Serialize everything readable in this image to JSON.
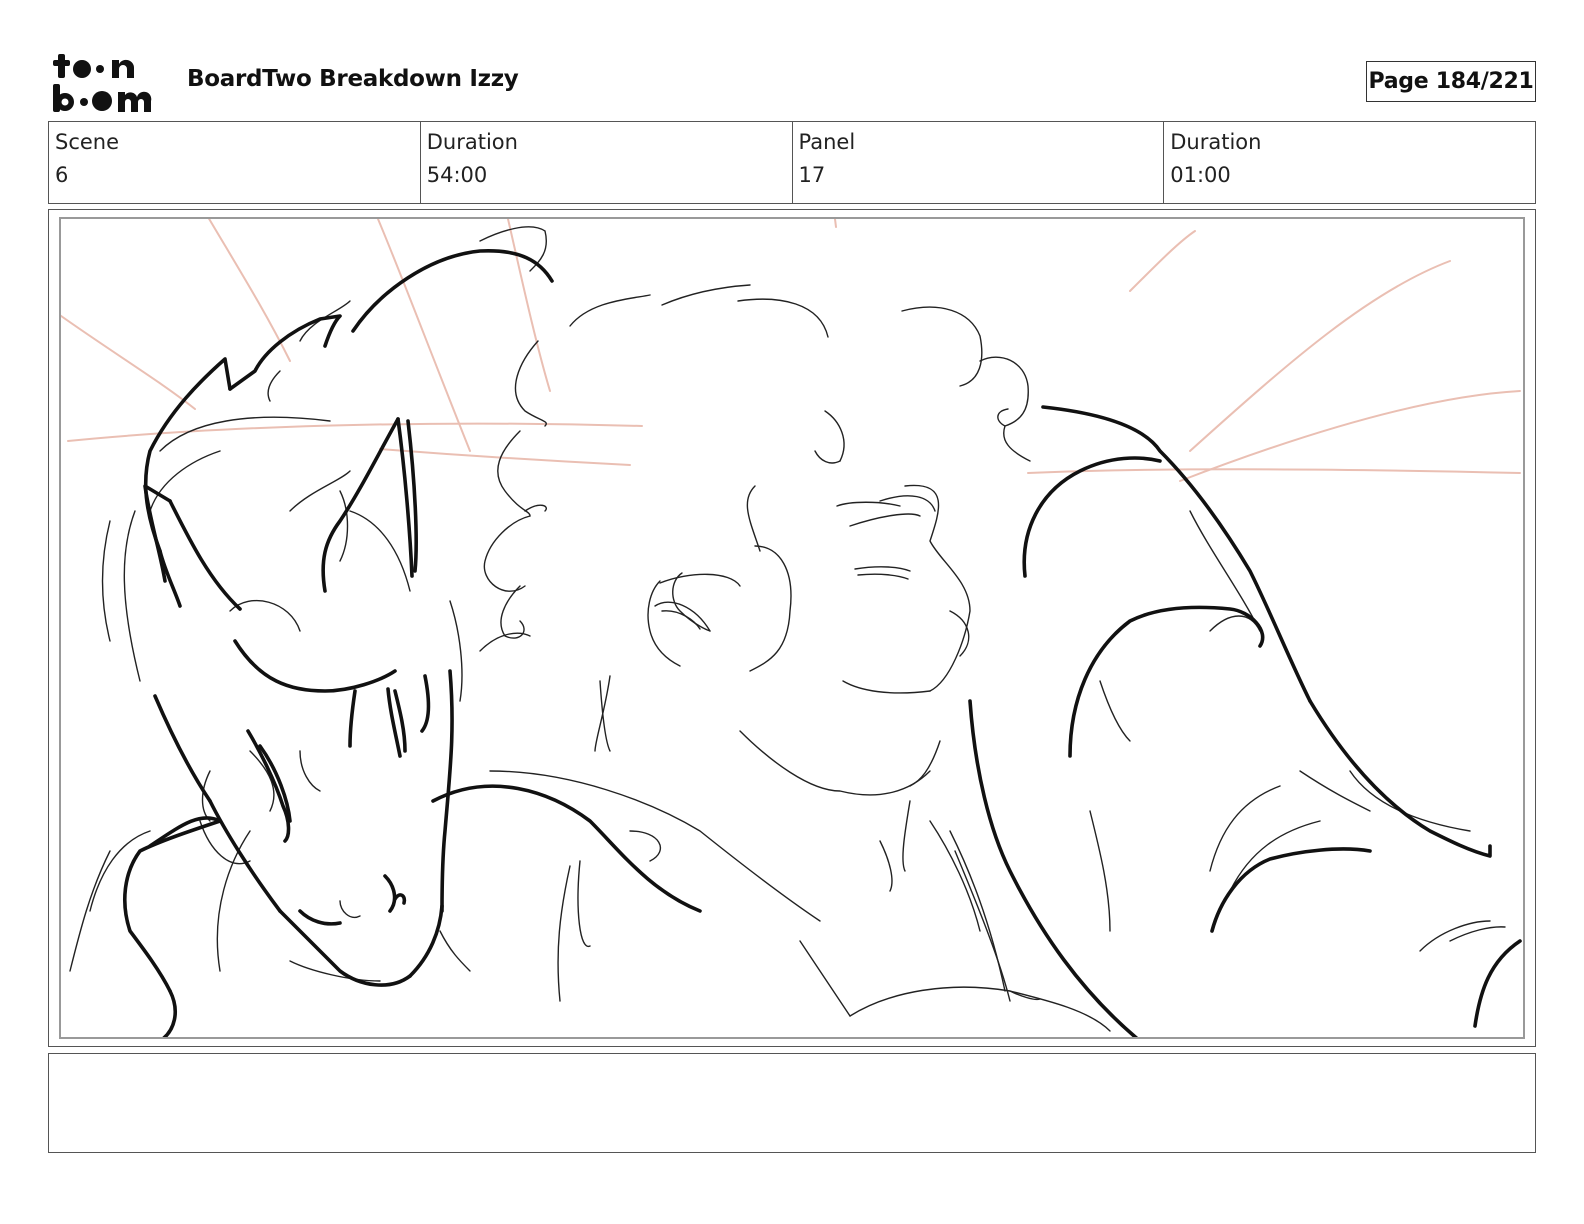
{
  "header": {
    "logo_text_line1": "toon",
    "logo_text_line2": "boom",
    "title": "BoardTwo Breakdown Izzy",
    "page": "Page 184/221"
  },
  "info": {
    "scene_label": "Scene",
    "scene_value": "6",
    "scene_duration_label": "Duration",
    "scene_duration_value": "54:00",
    "panel_label": "Panel",
    "panel_value": "17",
    "panel_duration_label": "Duration",
    "panel_duration_value": "01:00"
  },
  "notes": {
    "text": ""
  },
  "colors": {
    "frame": "#555555",
    "sketch_guide": "#e8b4a8",
    "sketch_ink": "#111111"
  }
}
